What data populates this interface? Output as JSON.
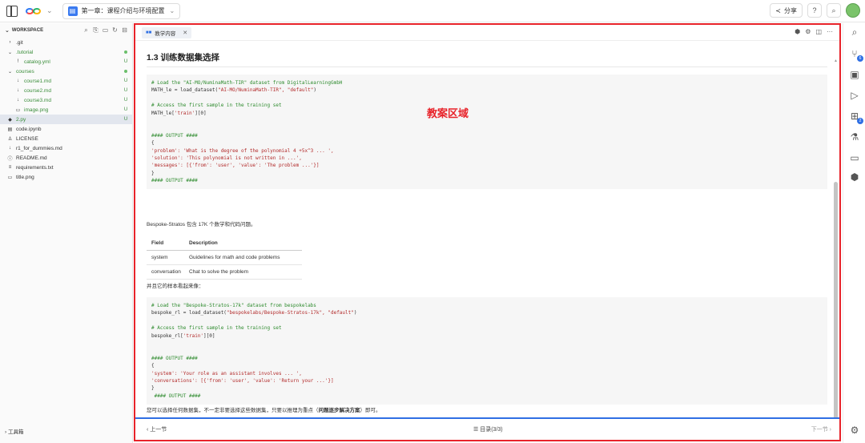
{
  "topbar": {
    "chapter_title": "第一章：课程介绍与环境配置",
    "share_label": "分享",
    "help_icon": "?",
    "search_icon": "⌕"
  },
  "sidebar": {
    "workspace_label": "WORKSPACE",
    "items": [
      {
        "label": ".git",
        "icon": "›",
        "indent": 0,
        "status": ""
      },
      {
        "label": ".tutorial",
        "icon": "⌄",
        "indent": 0,
        "status": "dot"
      },
      {
        "label": "catalog.yml",
        "icon": "!",
        "indent": 1,
        "status": "U"
      },
      {
        "label": "courses",
        "icon": "⌄",
        "indent": 0,
        "status": "dot"
      },
      {
        "label": "course1.md",
        "icon": "↓",
        "indent": 1,
        "status": "U"
      },
      {
        "label": "course2.md",
        "icon": "↓",
        "indent": 1,
        "status": "U"
      },
      {
        "label": "course3.md",
        "icon": "↓",
        "indent": 1,
        "status": "U"
      },
      {
        "label": "image.png",
        "icon": "▭",
        "indent": 1,
        "status": "U"
      },
      {
        "label": "2.py",
        "icon": "◆",
        "indent": 0,
        "status": "U"
      },
      {
        "label": "code.ipynb",
        "icon": "▤",
        "indent": 0,
        "status": ""
      },
      {
        "label": "LICENSE",
        "icon": "♙",
        "indent": 0,
        "status": ""
      },
      {
        "label": "r1_for_dummies.md",
        "icon": "↓",
        "indent": 0,
        "status": ""
      },
      {
        "label": "README.md",
        "icon": "ⓘ",
        "indent": 0,
        "status": ""
      },
      {
        "label": "requirements.txt",
        "icon": "≡",
        "indent": 0,
        "status": ""
      },
      {
        "label": "title.png",
        "icon": "▭",
        "indent": 0,
        "status": ""
      }
    ],
    "toolbox_label": "工具箱"
  },
  "activity": {
    "scm_badge": "6",
    "ext_badge": "2"
  },
  "main": {
    "tab_label": "教学内容",
    "heading": "1.3 训练数据集选择",
    "annotation": "教案区域",
    "code1": [
      {
        "t": "cm",
        "s": "# Load the \"AI-MO/NuminaMath-TIR\" dataset from DigitalLearningGmbH"
      },
      {
        "t": "mix",
        "a": "MATH_le = load_dataset(",
        "b": "\"AI-MO/NuminaMath-TIR\", \"default\"",
        "c": ")"
      },
      {
        "t": "blank"
      },
      {
        "t": "cm",
        "s": "# Access the first sample in the training set"
      },
      {
        "t": "mix",
        "a": "MATH_le[",
        "b": "'train'",
        "c": "][0]"
      },
      {
        "t": "blank"
      },
      {
        "t": "blank"
      },
      {
        "t": "cm",
        "s": "#### OUTPUT ####"
      },
      {
        "t": "tx",
        "s": "{"
      },
      {
        "t": "mix",
        "a": "",
        "b": "'problem': 'What is the degree of the polynomial 4 +5x^3 ... ',",
        "c": ""
      },
      {
        "t": "mix",
        "a": "",
        "b": "'solution': 'This polynomial is not written in ...',",
        "c": ""
      },
      {
        "t": "mix",
        "a": "",
        "b": "'messages': [{'from': 'user', 'value': 'The problem ...'}]",
        "c": ""
      },
      {
        "t": "tx",
        "s": "}"
      },
      {
        "t": "cm",
        "s": "#### OUTPUT ####"
      }
    ],
    "para1": "Bespoke-Stratos 包含 17K 个数学和代码问题。",
    "table": {
      "headers": [
        "Field",
        "Description"
      ],
      "rows": [
        [
          "system",
          "Guidelines for math and code problems"
        ],
        [
          "conversation",
          "Chat to solve the problem"
        ]
      ]
    },
    "para2": "并且它的样本看起来像：",
    "code2": [
      {
        "t": "cm",
        "s": "# Load the \"Bespoke-Stratos-17k\" dataset from bespokelabs"
      },
      {
        "t": "mix",
        "a": "bespoke_rl = load_dataset(",
        "b": "\"bespokelabs/Bespoke-Stratos-17k\", \"default\"",
        "c": ")"
      },
      {
        "t": "blank"
      },
      {
        "t": "cm",
        "s": "# Access the first sample in the training set"
      },
      {
        "t": "mix",
        "a": "bespoke_rl[",
        "b": "'train'",
        "c": "][0]"
      },
      {
        "t": "blank"
      },
      {
        "t": "blank"
      },
      {
        "t": "cm",
        "s": "#### OUTPUT ####"
      },
      {
        "t": "tx",
        "s": "{"
      },
      {
        "t": "mix",
        "a": "",
        "b": "'system': 'Your role as an assistant involves ... ',",
        "c": ""
      },
      {
        "t": "mix",
        "a": "",
        "b": "'conversations': [{'from': 'user', 'value': 'Return your ...'}]",
        "c": ""
      },
      {
        "t": "tx",
        "s": "}"
      },
      {
        "t": "cm",
        "s": " #### OUTPUT ####"
      }
    ],
    "para3_a": "您可以选择任何数据集，不一定非要选择这些数据集，只要以推理为重点（",
    "para3_b": "问题逐步解决方案",
    "para3_c": "）即可。"
  },
  "footer": {
    "prev_label": "‹  上一节",
    "toc_label": "☰ 目录(3/3)",
    "next_label": "下一节  ›"
  }
}
